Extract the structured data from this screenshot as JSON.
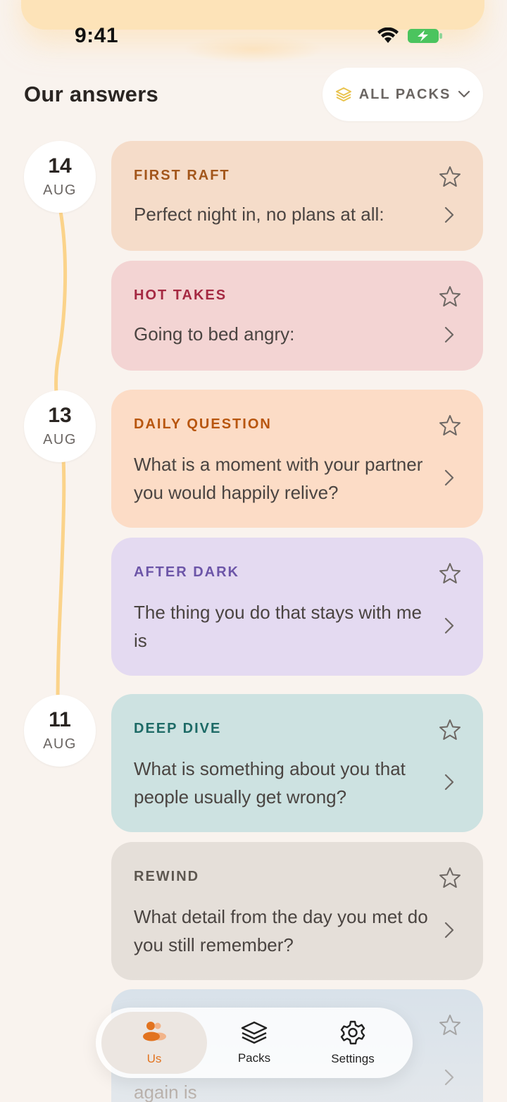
{
  "status_bar": {
    "time": "9:41"
  },
  "header": {
    "title": "Our answers",
    "filter_label": "ALL PACKS"
  },
  "dates": [
    {
      "day": "14",
      "month": "AUG"
    },
    {
      "day": "13",
      "month": "AUG"
    },
    {
      "day": "11",
      "month": "AUG"
    }
  ],
  "cards": [
    {
      "category": "FIRST RAFT",
      "text": "Perfect night in, no plans at all:",
      "bg": "#f5dcc9",
      "accent": "#a3561b"
    },
    {
      "category": "HOT TAKES",
      "text": "Going to bed angry:",
      "bg": "#f3d4d3",
      "accent": "#a52942"
    },
    {
      "category": "DAILY QUESTION",
      "text": "What is a moment with your partner you would happily relive?",
      "bg": "#fcdcc6",
      "accent": "#b8560f"
    },
    {
      "category": "AFTER DARK",
      "text": "The thing you do that stays with me is",
      "bg": "#e4daf1",
      "accent": "#6c55a8"
    },
    {
      "category": "DEEP DIVE",
      "text": "What is something about you that people usually get wrong?",
      "bg": "#cde2e1",
      "accent": "#1d6a66"
    },
    {
      "category": "REWIND",
      "text": "What detail from the day you met do you still remember?",
      "bg": "#e5dfd9",
      "accent": "#5d5750"
    },
    {
      "category": "",
      "text": "again is",
      "bg": "#d7e1ea",
      "accent": "#3d8fd1"
    }
  ],
  "nav": {
    "items": [
      {
        "label": "Us"
      },
      {
        "label": "Packs"
      },
      {
        "label": "Settings"
      }
    ]
  },
  "colors": {
    "background": "#f9f3ee",
    "accent_orange": "#e2731f",
    "timeline": "#fbd38a"
  }
}
